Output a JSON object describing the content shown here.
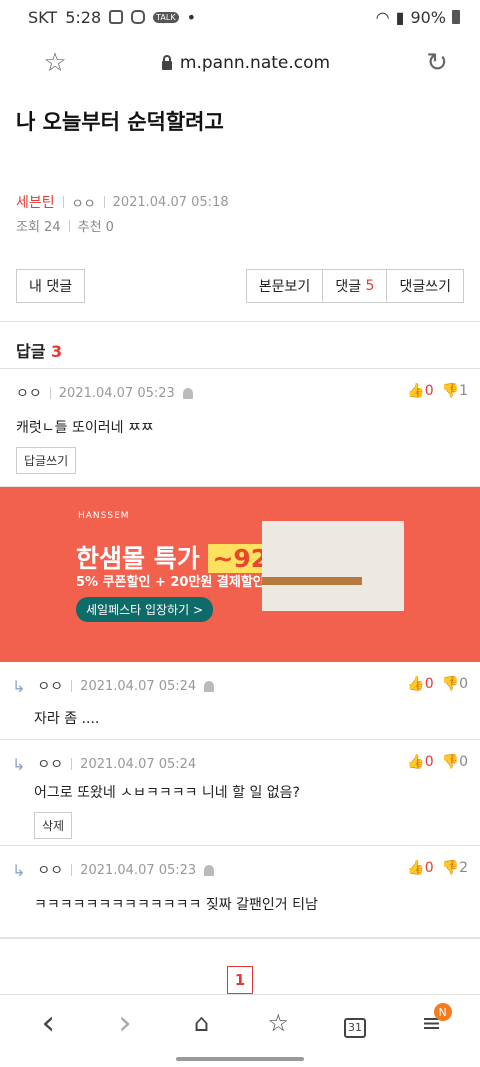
{
  "status": {
    "carrier": "SKT",
    "time": "5:28",
    "dot": "•",
    "talk": "TALK",
    "battery": "90%"
  },
  "browser": {
    "url": "m.pann.nate.com",
    "star": "☆",
    "reload": "↻"
  },
  "post": {
    "title": "나 오늘부터 순덕할려고",
    "author": "세븐틴",
    "nick": "ㅇㅇ",
    "date": "2021.04.07 05:18",
    "views": "조회 24",
    "recommends": "추천 0"
  },
  "buttons": {
    "my_comments": "내 댓글",
    "view_body": "본문보기",
    "comments": "댓글",
    "comments_count": "5",
    "write_comment": "댓글쓰기"
  },
  "replies": {
    "label": "답글",
    "count": "3"
  },
  "comment_main": {
    "nick": "ㅇㅇ",
    "date": "2021.04.07 05:23",
    "up": "0",
    "down": "1",
    "text": "캐럿ㄴ들 또이러네 ㅉㅉ",
    "reply_btn": "답글쓰기"
  },
  "ad": {
    "brand": "HANSSEM",
    "headline": "한샘몰 특가",
    "headline_hl": "~92%",
    "sub": "5% 쿠폰할인 + 20만원 결제할인",
    "cta": "세일페스타 입장하기 >"
  },
  "sub_comments": [
    {
      "nick": "ㅇㅇ",
      "date": "2021.04.07 05:24",
      "up": "0",
      "down": "0",
      "text": "자라 좀 ....",
      "button": ""
    },
    {
      "nick": "ㅇㅇ",
      "date": "2021.04.07 05:24",
      "up": "0",
      "down": "0",
      "text": "어그로 또왔네 ㅅㅂㅋㅋㅋㅋ 니네 할 일 없음?",
      "button": "삭제"
    },
    {
      "nick": "ㅇㅇ",
      "date": "2021.04.07 05:23",
      "up": "0",
      "down": "2",
      "text": "ㅋㅋㅋㅋㅋㅋㅋㅋㅋㅋㅋㅋㅋ 짖짜 갈팬인거 티남",
      "button": ""
    }
  ],
  "pager": {
    "current": "1"
  },
  "navbar": {
    "back": "‹",
    "forward": "›",
    "home": "⌂",
    "bookmarks": "☆",
    "tabs": "31",
    "menu": "≡",
    "badge": "N"
  },
  "colors": {
    "accent": "#e53935",
    "ad_bg": "#f2604e",
    "ad_highlight": "#ffe160",
    "badge": "#f47b20"
  }
}
